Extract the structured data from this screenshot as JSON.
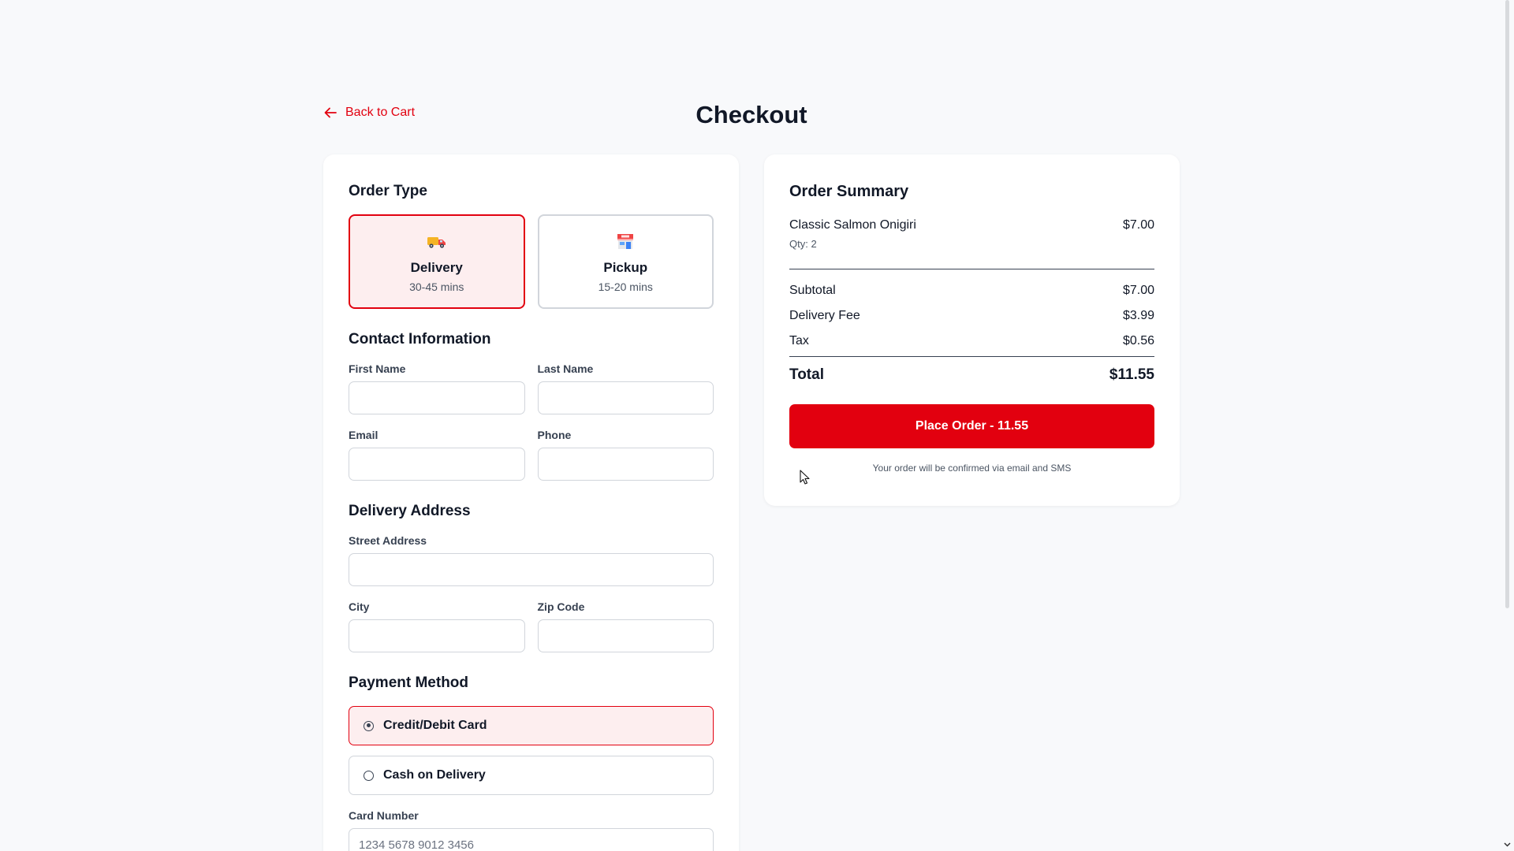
{
  "header": {
    "back_label": "Back to Cart",
    "title": "Checkout"
  },
  "order_type": {
    "title": "Order Type",
    "options": [
      {
        "label": "Delivery",
        "time": "30-45 mins",
        "icon": "delivery-truck-icon",
        "selected": true
      },
      {
        "label": "Pickup",
        "time": "15-20 mins",
        "icon": "store-icon",
        "selected": false
      }
    ]
  },
  "contact": {
    "title": "Contact Information",
    "first_name_label": "First Name",
    "first_name_value": "",
    "last_name_label": "Last Name",
    "last_name_value": "",
    "email_label": "Email",
    "email_value": "",
    "phone_label": "Phone",
    "phone_value": ""
  },
  "address": {
    "title": "Delivery Address",
    "street_label": "Street Address",
    "street_value": "",
    "city_label": "City",
    "city_value": "",
    "zip_label": "Zip Code",
    "zip_value": ""
  },
  "payment": {
    "title": "Payment Method",
    "options": [
      {
        "label": "Credit/Debit Card",
        "selected": true
      },
      {
        "label": "Cash on Delivery",
        "selected": false
      }
    ],
    "card_number_label": "Card Number",
    "card_number_placeholder": "1234 5678 9012 3456"
  },
  "summary": {
    "title": "Order Summary",
    "items": [
      {
        "name": "Classic Salmon Onigiri",
        "qty": "Qty: 2",
        "price": "$7.00"
      }
    ],
    "subtotal_label": "Subtotal",
    "subtotal": "$7.00",
    "delivery_fee_label": "Delivery Fee",
    "delivery_fee": "$3.99",
    "tax_label": "Tax",
    "tax": "$0.56",
    "total_label": "Total",
    "total": "$11.55",
    "place_order_label": "Place Order - 11.55",
    "confirm_note": "Your order will be confirmed via email and SMS"
  },
  "colors": {
    "accent": "#e2000f",
    "selected_bg": "#fdeeef",
    "page_bg": "#f8f9fb"
  }
}
